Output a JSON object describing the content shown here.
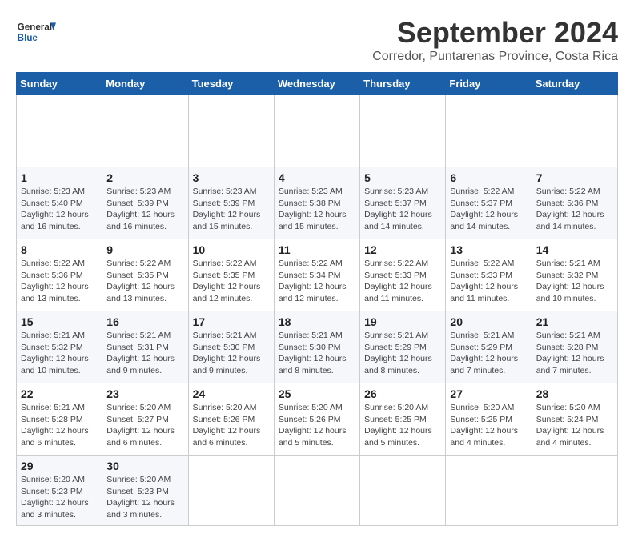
{
  "app": {
    "logo_line1": "General",
    "logo_line2": "Blue"
  },
  "header": {
    "month_title": "September 2024",
    "subtitle": "Corredor, Puntarenas Province, Costa Rica"
  },
  "calendar": {
    "days_of_week": [
      "Sunday",
      "Monday",
      "Tuesday",
      "Wednesday",
      "Thursday",
      "Friday",
      "Saturday"
    ],
    "weeks": [
      [
        {
          "day": "",
          "info": ""
        },
        {
          "day": "",
          "info": ""
        },
        {
          "day": "",
          "info": ""
        },
        {
          "day": "",
          "info": ""
        },
        {
          "day": "",
          "info": ""
        },
        {
          "day": "",
          "info": ""
        },
        {
          "day": "",
          "info": ""
        }
      ]
    ]
  },
  "cells": {
    "week1": [
      {
        "num": "",
        "sunrise": "",
        "sunset": "",
        "daylight": ""
      },
      {
        "num": "",
        "sunrise": "",
        "sunset": "",
        "daylight": ""
      },
      {
        "num": "",
        "sunrise": "",
        "sunset": "",
        "daylight": ""
      },
      {
        "num": "",
        "sunrise": "",
        "sunset": "",
        "daylight": ""
      },
      {
        "num": "",
        "sunrise": "",
        "sunset": "",
        "daylight": ""
      },
      {
        "num": "",
        "sunrise": "",
        "sunset": "",
        "daylight": ""
      },
      {
        "num": "",
        "sunrise": "",
        "sunset": "",
        "daylight": ""
      }
    ]
  },
  "rows": [
    [
      null,
      null,
      null,
      null,
      null,
      null,
      null
    ],
    [
      {
        "n": "1",
        "s1": "Sunrise: 5:23 AM",
        "s2": "Sunset: 5:40 PM",
        "d": "Daylight: 12 hours and 16 minutes."
      },
      {
        "n": "2",
        "s1": "Sunrise: 5:23 AM",
        "s2": "Sunset: 5:39 PM",
        "d": "Daylight: 12 hours and 16 minutes."
      },
      {
        "n": "3",
        "s1": "Sunrise: 5:23 AM",
        "s2": "Sunset: 5:39 PM",
        "d": "Daylight: 12 hours and 15 minutes."
      },
      {
        "n": "4",
        "s1": "Sunrise: 5:23 AM",
        "s2": "Sunset: 5:38 PM",
        "d": "Daylight: 12 hours and 15 minutes."
      },
      {
        "n": "5",
        "s1": "Sunrise: 5:23 AM",
        "s2": "Sunset: 5:37 PM",
        "d": "Daylight: 12 hours and 14 minutes."
      },
      {
        "n": "6",
        "s1": "Sunrise: 5:22 AM",
        "s2": "Sunset: 5:37 PM",
        "d": "Daylight: 12 hours and 14 minutes."
      },
      {
        "n": "7",
        "s1": "Sunrise: 5:22 AM",
        "s2": "Sunset: 5:36 PM",
        "d": "Daylight: 12 hours and 14 minutes."
      }
    ],
    [
      {
        "n": "8",
        "s1": "Sunrise: 5:22 AM",
        "s2": "Sunset: 5:36 PM",
        "d": "Daylight: 12 hours and 13 minutes."
      },
      {
        "n": "9",
        "s1": "Sunrise: 5:22 AM",
        "s2": "Sunset: 5:35 PM",
        "d": "Daylight: 12 hours and 13 minutes."
      },
      {
        "n": "10",
        "s1": "Sunrise: 5:22 AM",
        "s2": "Sunset: 5:35 PM",
        "d": "Daylight: 12 hours and 12 minutes."
      },
      {
        "n": "11",
        "s1": "Sunrise: 5:22 AM",
        "s2": "Sunset: 5:34 PM",
        "d": "Daylight: 12 hours and 12 minutes."
      },
      {
        "n": "12",
        "s1": "Sunrise: 5:22 AM",
        "s2": "Sunset: 5:33 PM",
        "d": "Daylight: 12 hours and 11 minutes."
      },
      {
        "n": "13",
        "s1": "Sunrise: 5:22 AM",
        "s2": "Sunset: 5:33 PM",
        "d": "Daylight: 12 hours and 11 minutes."
      },
      {
        "n": "14",
        "s1": "Sunrise: 5:21 AM",
        "s2": "Sunset: 5:32 PM",
        "d": "Daylight: 12 hours and 10 minutes."
      }
    ],
    [
      {
        "n": "15",
        "s1": "Sunrise: 5:21 AM",
        "s2": "Sunset: 5:32 PM",
        "d": "Daylight: 12 hours and 10 minutes."
      },
      {
        "n": "16",
        "s1": "Sunrise: 5:21 AM",
        "s2": "Sunset: 5:31 PM",
        "d": "Daylight: 12 hours and 9 minutes."
      },
      {
        "n": "17",
        "s1": "Sunrise: 5:21 AM",
        "s2": "Sunset: 5:30 PM",
        "d": "Daylight: 12 hours and 9 minutes."
      },
      {
        "n": "18",
        "s1": "Sunrise: 5:21 AM",
        "s2": "Sunset: 5:30 PM",
        "d": "Daylight: 12 hours and 8 minutes."
      },
      {
        "n": "19",
        "s1": "Sunrise: 5:21 AM",
        "s2": "Sunset: 5:29 PM",
        "d": "Daylight: 12 hours and 8 minutes."
      },
      {
        "n": "20",
        "s1": "Sunrise: 5:21 AM",
        "s2": "Sunset: 5:29 PM",
        "d": "Daylight: 12 hours and 7 minutes."
      },
      {
        "n": "21",
        "s1": "Sunrise: 5:21 AM",
        "s2": "Sunset: 5:28 PM",
        "d": "Daylight: 12 hours and 7 minutes."
      }
    ],
    [
      {
        "n": "22",
        "s1": "Sunrise: 5:21 AM",
        "s2": "Sunset: 5:28 PM",
        "d": "Daylight: 12 hours and 6 minutes."
      },
      {
        "n": "23",
        "s1": "Sunrise: 5:20 AM",
        "s2": "Sunset: 5:27 PM",
        "d": "Daylight: 12 hours and 6 minutes."
      },
      {
        "n": "24",
        "s1": "Sunrise: 5:20 AM",
        "s2": "Sunset: 5:26 PM",
        "d": "Daylight: 12 hours and 6 minutes."
      },
      {
        "n": "25",
        "s1": "Sunrise: 5:20 AM",
        "s2": "Sunset: 5:26 PM",
        "d": "Daylight: 12 hours and 5 minutes."
      },
      {
        "n": "26",
        "s1": "Sunrise: 5:20 AM",
        "s2": "Sunset: 5:25 PM",
        "d": "Daylight: 12 hours and 5 minutes."
      },
      {
        "n": "27",
        "s1": "Sunrise: 5:20 AM",
        "s2": "Sunset: 5:25 PM",
        "d": "Daylight: 12 hours and 4 minutes."
      },
      {
        "n": "28",
        "s1": "Sunrise: 5:20 AM",
        "s2": "Sunset: 5:24 PM",
        "d": "Daylight: 12 hours and 4 minutes."
      }
    ],
    [
      {
        "n": "29",
        "s1": "Sunrise: 5:20 AM",
        "s2": "Sunset: 5:23 PM",
        "d": "Daylight: 12 hours and 3 minutes."
      },
      {
        "n": "30",
        "s1": "Sunrise: 5:20 AM",
        "s2": "Sunset: 5:23 PM",
        "d": "Daylight: 12 hours and 3 minutes."
      },
      null,
      null,
      null,
      null,
      null
    ]
  ]
}
